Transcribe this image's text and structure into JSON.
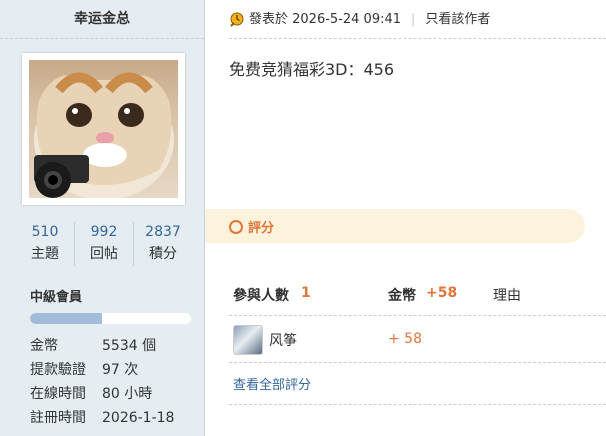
{
  "author": {
    "name": "幸运金总",
    "stats": [
      {
        "num": "510",
        "label": "主題"
      },
      {
        "num": "992",
        "label": "回帖"
      },
      {
        "num": "2837",
        "label": "積分"
      }
    ],
    "level": "中級會員",
    "level_progress": 0.45,
    "info": [
      {
        "key": "金幣",
        "value": "5534 個"
      },
      {
        "key": "提款驗證",
        "value": "97 次"
      },
      {
        "key": "在線時間",
        "value": "80 小時"
      },
      {
        "key": "註冊時間",
        "value": "2026-1-18"
      }
    ]
  },
  "post": {
    "published": "發表於 2026-5-24 09:41",
    "only_author": "只看該作者",
    "content": "免费竞猜福彩3D：456"
  },
  "rating": {
    "button": "評分",
    "participants_label": "參與人數",
    "participants_count": "1",
    "coins_label": "金幣",
    "coins_total": "+58",
    "reason_label": "理由",
    "entries": [
      {
        "user": "风筝",
        "coins": "+ 58"
      }
    ],
    "view_all": "查看全部評分"
  },
  "colors": {
    "sidebar_bg": "#e5edf2",
    "link": "#336699",
    "accent": "#e0763a",
    "rate_bar_bg": "#fdf3dd"
  },
  "icons": {
    "meta": "clock-icon",
    "rate": "ring-icon"
  }
}
